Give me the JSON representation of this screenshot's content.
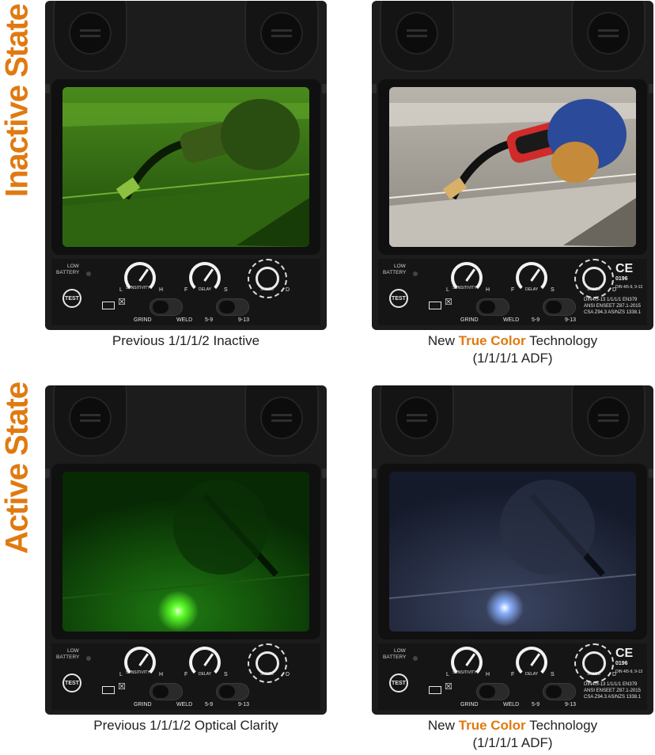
{
  "side_labels": {
    "top": "Inactive State",
    "bottom": "Active State"
  },
  "accent_color": "#e07a10",
  "panels": [
    {
      "id": "inactive-previous",
      "lens_tint": "green",
      "lens_state": "inactive",
      "caption_plain": "Previous 1/1/1/2 Inactive",
      "has_certification": false
    },
    {
      "id": "inactive-new",
      "lens_tint": "true-color",
      "lens_state": "inactive",
      "caption_prefix": "New ",
      "caption_highlight": "True Color",
      "caption_suffix": " Technology",
      "caption_line2": "(1/1/1/1 ADF)",
      "has_certification": true
    },
    {
      "id": "active-previous",
      "lens_tint": "green",
      "lens_state": "active",
      "caption_plain": "Previous 1/1/1/2 Optical Clarity",
      "has_certification": false
    },
    {
      "id": "active-new",
      "lens_tint": "true-color",
      "lens_state": "active",
      "caption_prefix": "New ",
      "caption_highlight": "True Color",
      "caption_suffix": " Technology",
      "caption_line2": "(1/1/1/1 ADF)",
      "has_certification": true
    }
  ],
  "control_panel": {
    "battery_label_1": "LOW",
    "battery_label_2": "BATTERY",
    "test_label": "TEST",
    "sensitivity_label": "SENSITIVITY",
    "sensitivity_low": "L",
    "sensitivity_high": "H",
    "delay_label": "DELAY",
    "delay_low": "F",
    "delay_high": "S",
    "shade_label": "SHADE",
    "shade_d": "D",
    "grind_label": "GRIND",
    "weld_label": "WELD",
    "range_1": "5-9",
    "range_2": "9-13",
    "ce_mark": "CE",
    "ce_code": "0196",
    "din_text": "DIN 4/5-9, 9-13",
    "standards_1": "DIN4/5-13 1/1/1/1 EN379",
    "standards_2": "ANSI ENSEET Z87.1-2015",
    "standards_3": "CSA Z94.3 AS/NZS 1338.1"
  }
}
